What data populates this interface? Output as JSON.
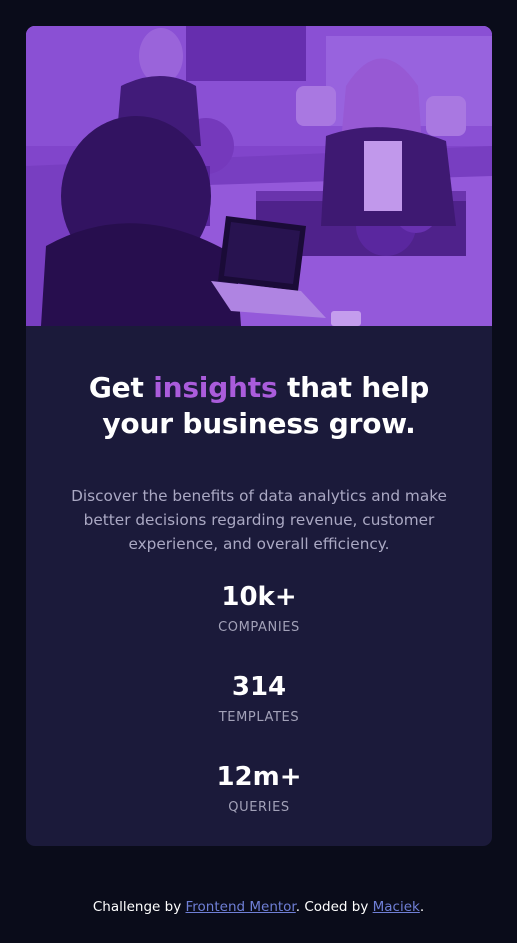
{
  "card": {
    "image": {
      "description_icon": "office-team-photo",
      "tint_color": "#9246dd"
    },
    "headline": {
      "before": "Get ",
      "accent": "insights",
      "after": " that help your business grow."
    },
    "description": "Discover the benefits of data analytics and make better decisions regarding revenue, customer experience, and overall efficiency.",
    "stats": [
      {
        "value": "10k+",
        "label": "companies"
      },
      {
        "value": "314",
        "label": "templates"
      },
      {
        "value": "12m+",
        "label": "queries"
      }
    ]
  },
  "footer": {
    "prefix": "Challenge by ",
    "link1": "Frontend Mentor",
    "middle": ". Coded by ",
    "link2": "Maciek",
    "suffix": "."
  },
  "colors": {
    "page_bg": "#0a0c1a",
    "card_bg": "#1b1a3a",
    "accent": "#aa5cdb",
    "link": "#6f7fd6"
  }
}
